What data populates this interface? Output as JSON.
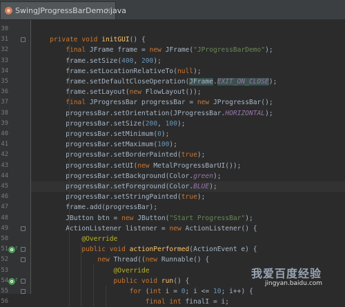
{
  "tab": {
    "filename": "SwingJProgressBarDemo.java",
    "close": "×"
  },
  "lines": [
    {
      "n": "30",
      "t": ""
    },
    {
      "n": "31",
      "t": "    private void initGUI() {"
    },
    {
      "n": "32",
      "t": "        final JFrame frame = new JFrame(\"JProgressBarDemo\");"
    },
    {
      "n": "33",
      "t": "        frame.setSize(400, 200);"
    },
    {
      "n": "34",
      "t": "        frame.setLocationRelativeTo(null);"
    },
    {
      "n": "35",
      "t": "        frame.setDefaultCloseOperation(JFrame.EXIT_ON_CLOSE);"
    },
    {
      "n": "36",
      "t": "        frame.setLayout(new FlowLayout());"
    },
    {
      "n": "37",
      "t": "        final JProgressBar progressBar = new JProgressBar();"
    },
    {
      "n": "38",
      "t": "        progressBar.setOrientation(JProgressBar.HORIZONTAL);"
    },
    {
      "n": "39",
      "t": "        progressBar.setSize(200, 100);"
    },
    {
      "n": "40",
      "t": "        progressBar.setMinimum(0);"
    },
    {
      "n": "41",
      "t": "        progressBar.setMaximum(100);"
    },
    {
      "n": "42",
      "t": "        progressBar.setBorderPainted(true);"
    },
    {
      "n": "43",
      "t": "        progressBar.setUI(new MetalProgressBarUI());"
    },
    {
      "n": "44",
      "t": "        progressBar.setBackground(Color.green);"
    },
    {
      "n": "45",
      "t": "        progressBar.setForeground(Color.BLUE);"
    },
    {
      "n": "46",
      "t": "        progressBar.setStringPainted(true);"
    },
    {
      "n": "47",
      "t": "        frame.add(progressBar);"
    },
    {
      "n": "48",
      "t": "        JButton btn = new JButton(\"Start ProgressBar\");"
    },
    {
      "n": "49",
      "t": "        ActionListener listener = new ActionListener() {"
    },
    {
      "n": "50",
      "t": "            @Override"
    },
    {
      "n": "51",
      "t": "            public void actionPerformed(ActionEvent e) {"
    },
    {
      "n": "52",
      "t": "                new Thread((new Runnable() {"
    },
    {
      "n": "53",
      "t": "                    @Override"
    },
    {
      "n": "54",
      "t": "                    public void run() {"
    },
    {
      "n": "55",
      "t": "                        for (int i = 0; i <= 10; i++) {"
    },
    {
      "n": "56",
      "t": "                            final int finalI = i;"
    }
  ],
  "watermark": {
    "text": "我爱百度经验",
    "url": "jingyan.baidu.com"
  }
}
